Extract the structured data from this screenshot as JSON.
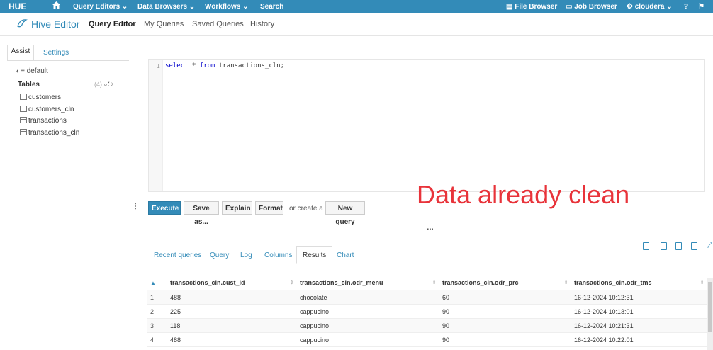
{
  "topnav": {
    "logo": "HUE",
    "home_icon": "home-icon",
    "menus": [
      "Query Editors",
      "Data Browsers",
      "Workflows"
    ],
    "search": "Search",
    "file_browser": "File Browser",
    "job_browser": "Job Browser",
    "user": "cloudera",
    "brand_color": "#338bb8"
  },
  "subnav": {
    "title": "Hive Editor",
    "tabs": [
      "Query Editor",
      "My Queries",
      "Saved Queries",
      "History"
    ]
  },
  "assist": {
    "tabs": [
      "Assist",
      "Settings"
    ],
    "database": "default",
    "tables_label": "Tables",
    "tables_count": "(4)",
    "tables": [
      "customers",
      "customers_cln",
      "transactions",
      "transactions_cln"
    ]
  },
  "editor": {
    "line_number": "1",
    "query_keyword1": "select",
    "query_mid": " * ",
    "query_keyword2": "from",
    "query_table": " transactions_cln;"
  },
  "actions": {
    "execute": "Execute",
    "save_as": "Save as...",
    "explain": "Explain",
    "format": "Format",
    "or_create": "or create a",
    "new_query": "New query"
  },
  "annotation": {
    "text": "Data already clean",
    "color": "#e8333a"
  },
  "results": {
    "tabs": [
      "Recent queries",
      "Query",
      "Log",
      "Columns",
      "Results",
      "Chart"
    ],
    "active_tab": "Results",
    "columns": [
      "transactions_cln.cust_id",
      "transactions_cln.odr_menu",
      "transactions_cln.odr_prc",
      "transactions_cln.odr_tms"
    ],
    "rows": [
      [
        "1",
        "488",
        "chocolate",
        "60",
        "16-12-2024 10:12:31"
      ],
      [
        "2",
        "225",
        "cappucino",
        "90",
        "16-12-2024 10:13:01"
      ],
      [
        "3",
        "118",
        "cappucino",
        "90",
        "16-12-2024 10:21:31"
      ],
      [
        "4",
        "488",
        "cappucino",
        "90",
        "16-12-2024 10:22:01"
      ]
    ]
  }
}
